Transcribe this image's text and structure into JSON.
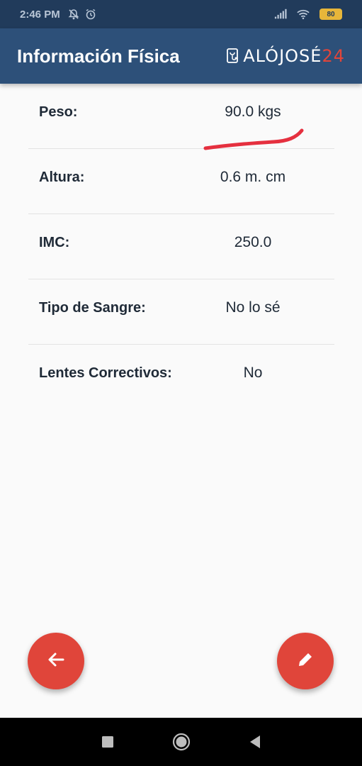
{
  "status_bar": {
    "time": "2:46 PM",
    "battery": "80"
  },
  "app_bar": {
    "title": "Información Física",
    "brand_main": "ALÓJOSÉ",
    "brand_num": "24"
  },
  "rows": [
    {
      "label": "Peso:",
      "value": "90.0 kgs"
    },
    {
      "label": "Altura:",
      "value": "0.6 m. cm"
    },
    {
      "label": "IMC:",
      "value": "250.0"
    },
    {
      "label": "Tipo de Sangre:",
      "value": "No lo sé"
    },
    {
      "label": "Lentes Correctivos:",
      "value": "No"
    }
  ],
  "icons": {
    "back_fab": "arrow-left-icon",
    "edit_fab": "pencil-icon",
    "nav_recent": "square-icon",
    "nav_home": "circle-icon",
    "nav_back": "triangle-back-icon"
  },
  "colors": {
    "status_bar": "#213b5b",
    "app_bar": "#2d5079",
    "accent": "#e0453a",
    "annotation": "#e5303f"
  }
}
